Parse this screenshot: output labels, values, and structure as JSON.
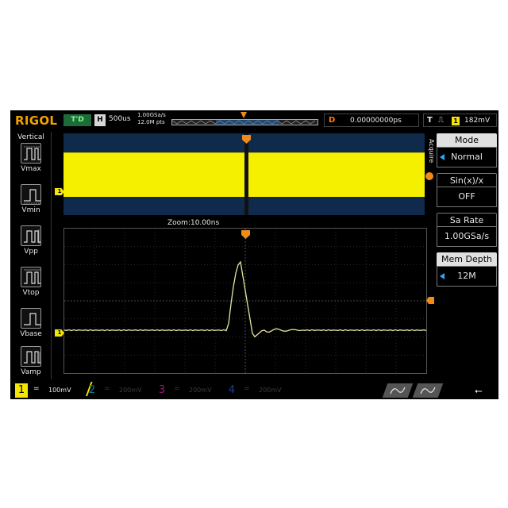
{
  "brand": {
    "logo": "RIGOL"
  },
  "topbar": {
    "trigger_status": "T'D",
    "horizontal_label": "H",
    "timebase": "500us",
    "sample_rate": "1.00GSa/s",
    "memory_points": "12.0M pts",
    "delay_label": "D",
    "delay_value": "0.00000000ps",
    "trigger_label": "T",
    "trigger_source": "1",
    "trigger_level": "182mV"
  },
  "left_panel": {
    "title": "Vertical",
    "items": [
      {
        "label": "Vmax"
      },
      {
        "label": "Vmin"
      },
      {
        "label": "Vpp"
      },
      {
        "label": "Vtop"
      },
      {
        "label": "Vbase"
      },
      {
        "label": "Vamp"
      }
    ]
  },
  "zoom": {
    "label": "Zoom:10.00ns"
  },
  "channel_marker": "1",
  "right_panel": {
    "section_label": "Acquire",
    "items": [
      {
        "title": "Mode",
        "value": "Normal",
        "has_arrow": true
      },
      {
        "title": "Sin(x)/x",
        "value": "OFF",
        "has_arrow": false
      },
      {
        "title": "Sa Rate",
        "value": "1.00GSa/s",
        "has_arrow": false
      },
      {
        "title": "Mem Depth",
        "value": "12M",
        "has_arrow": true
      }
    ]
  },
  "channels": [
    {
      "number": "1",
      "coupling": "=",
      "scale": "100mV",
      "color": "#f4e600",
      "active": true
    },
    {
      "number": "2",
      "coupling": "=",
      "scale": "200mV",
      "color": "#0d7f8a",
      "active": false
    },
    {
      "number": "3",
      "coupling": "=",
      "scale": "200mV",
      "color": "#8e1c6b",
      "active": false
    },
    {
      "number": "4",
      "coupling": "=",
      "scale": "200mV",
      "color": "#1d3f8f",
      "active": false
    }
  ],
  "colors": {
    "background": "#000000",
    "ch1_trace": "#e8e6a0",
    "overview_fill": "#f4f000",
    "overview_bg": "#102a4c",
    "accent_orange": "#f08b1a",
    "logo": "#f2a200"
  },
  "icons": [
    "usb-icon",
    "generator-1-icon",
    "generator-2-icon",
    "trigger-edge-icon"
  ]
}
